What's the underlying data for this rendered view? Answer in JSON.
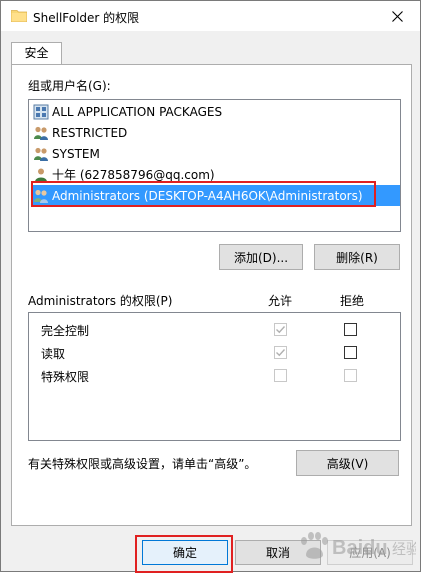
{
  "window": {
    "title": "ShellFolder 的权限"
  },
  "tabs": [
    {
      "label": "安全"
    }
  ],
  "groups": {
    "label": "组或用户名(G):",
    "items": [
      {
        "label": "ALL APPLICATION PACKAGES",
        "icon": "app-packages-icon",
        "selected": false
      },
      {
        "label": "RESTRICTED",
        "icon": "users-group-icon",
        "selected": false
      },
      {
        "label": "SYSTEM",
        "icon": "users-group-icon",
        "selected": false
      },
      {
        "label": "十年 (627858796@qq.com)",
        "icon": "user-icon",
        "selected": false
      },
      {
        "label": "Administrators (DESKTOP-A4AH6OK\\Administrators)",
        "icon": "users-group-icon",
        "selected": true
      }
    ]
  },
  "buttons": {
    "add": "添加(D)...",
    "remove": "删除(R)",
    "advanced": "高级(V)"
  },
  "permissions": {
    "label": "Administrators 的权限(P)",
    "allow_header": "允许",
    "deny_header": "拒绝",
    "rows": [
      {
        "name": "完全控制",
        "allow": true,
        "allow_enabled": false,
        "deny": false,
        "deny_enabled": true
      },
      {
        "name": "读取",
        "allow": true,
        "allow_enabled": false,
        "deny": false,
        "deny_enabled": true
      },
      {
        "name": "特殊权限",
        "allow": false,
        "allow_enabled": false,
        "deny": false,
        "deny_enabled": false
      }
    ]
  },
  "advanced_hint": "有关特殊权限或高级设置，请单击“高级”。",
  "footer": {
    "ok": "确定",
    "cancel": "取消",
    "apply": "应用(A)"
  },
  "watermark": {
    "brand": "Baidu",
    "sub": "经验"
  },
  "colors": {
    "selection": "#3399ff",
    "highlight": "#e02020"
  }
}
